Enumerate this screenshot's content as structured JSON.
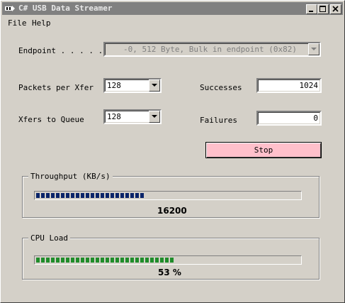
{
  "window": {
    "title": "C# USB Data Streamer"
  },
  "menu": {
    "file": "File",
    "help": "Help"
  },
  "endpoint": {
    "label": "Endpoint . . . . . . .",
    "value": "-0, 512 Byte, Bulk in endpoint (0x82)"
  },
  "packets_per_xfer": {
    "label": "Packets per Xfer",
    "value": "128"
  },
  "xfers_to_queue": {
    "label": "Xfers to Queue",
    "value": "128"
  },
  "successes": {
    "label": "Successes",
    "value": "1024"
  },
  "failures": {
    "label": "Failures",
    "value": "0"
  },
  "stop_button": {
    "label": "Stop",
    "color": "#ffc0cb"
  },
  "throughput": {
    "title": "Throughput (KB/s)",
    "value": "16200",
    "fill_fraction": 0.42,
    "bar_color": "#0a246a"
  },
  "cpu_load": {
    "title": "CPU Load",
    "value": "53 %",
    "fill_fraction": 0.53,
    "bar_color": "#1f8c2a"
  }
}
